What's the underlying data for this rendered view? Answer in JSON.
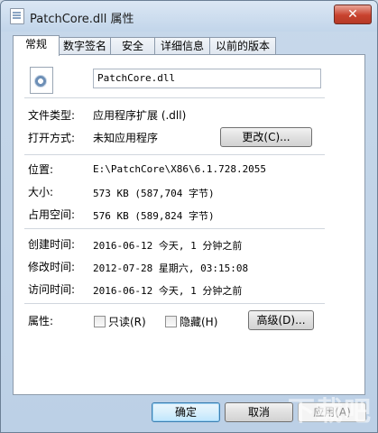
{
  "window": {
    "title": "PatchCore.dll 属性",
    "close_glyph": "✕"
  },
  "tabs": [
    "常规",
    "数字签名",
    "安全",
    "详细信息",
    "以前的版本"
  ],
  "file_name": "PatchCore.dll",
  "rows": {
    "type_label": "文件类型:",
    "type_value": "应用程序扩展 (.dll)",
    "open_label": "打开方式:",
    "open_value": "未知应用程序",
    "change_button": "更改(C)...",
    "location_label": "位置:",
    "location_value": "E:\\PatchCore\\X86\\6.1.728.2055",
    "size_label": "大小:",
    "size_value": "573 KB (587,704 字节)",
    "disk_label": "占用空间:",
    "disk_value": "576 KB (589,824 字节)",
    "created_label": "创建时间:",
    "created_value": "2016-06-12 今天, 1 分钟之前",
    "modified_label": "修改时间:",
    "modified_value": "2012-07-28 星期六, 03:15:08",
    "accessed_label": "访问时间:",
    "accessed_value": "2016-06-12 今天, 1 分钟之前",
    "attr_label": "属性:",
    "readonly_label": "只读(R)",
    "hidden_label": "隐藏(H)",
    "advanced_button": "高级(D)..."
  },
  "footer": {
    "ok": "确定",
    "cancel": "取消",
    "apply": "应用(A)"
  },
  "watermark": "下载吧"
}
